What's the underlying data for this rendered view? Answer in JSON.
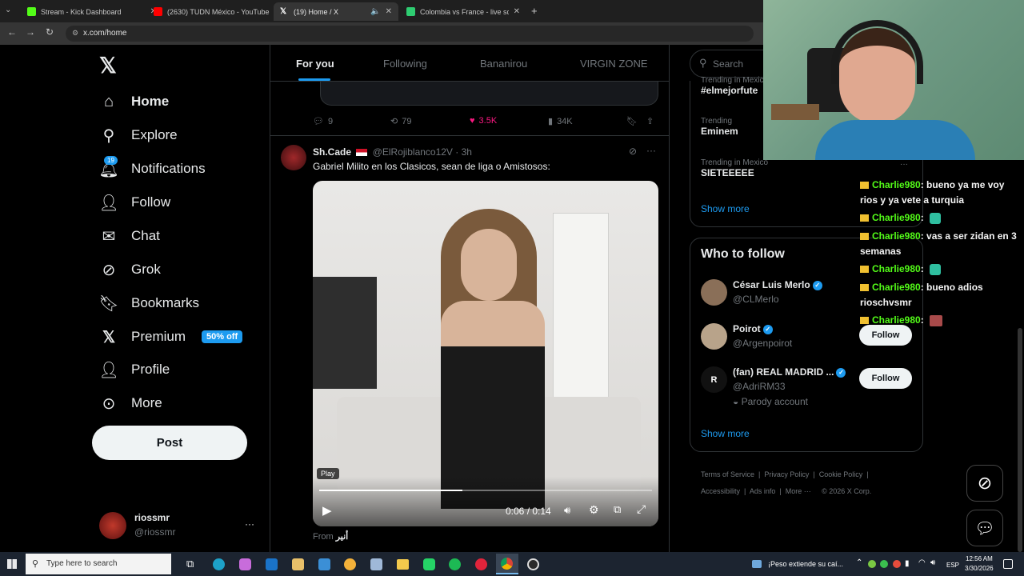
{
  "browser": {
    "tabs": [
      {
        "title": "Stream - Kick Dashboard",
        "color": "#53fc18"
      },
      {
        "title": "(2630) TUDN México - YouTube",
        "color": "#ff0000"
      },
      {
        "title": "(19) Home / X",
        "color": "#ffffff"
      },
      {
        "title": "Colombia vs France - live score",
        "color": "#2ecc71"
      }
    ],
    "url": "x.com/home"
  },
  "nav": {
    "items": [
      "Home",
      "Explore",
      "Notifications",
      "Follow",
      "Chat",
      "Grok",
      "Bookmarks",
      "Premium",
      "Profile",
      "More"
    ],
    "notif_badge": "19",
    "premium_badge": "50% off",
    "post": "Post",
    "account_name": "riossmr",
    "account_handle": "@riossmr"
  },
  "timeline": {
    "tabs": [
      "For you",
      "Following",
      "Bananirou",
      "VIRGIN ZONE"
    ],
    "prev_actions": {
      "replies": "9",
      "reposts": "79",
      "likes": "3.5K",
      "views": "34K"
    },
    "tweet": {
      "name": "Sh.Cade",
      "handle": "@ElRojiblanco12V",
      "time": "· 3h",
      "text": "Gabriel Milito en los Clasicos, sean de liga o Amistosos:",
      "play_label": "Play",
      "video_time": "0:06 / 0:14",
      "progress": 0.43,
      "from": "From",
      "from_name": "أنير"
    }
  },
  "right": {
    "search_placeholder": "Search",
    "trends": [
      {
        "meta": "Trending in Mexico",
        "name": "#elmejorfute"
      },
      {
        "meta": "Trending",
        "name": "Eminem"
      },
      {
        "meta": "Trending in Mexico",
        "name": "SIETEEEEE"
      }
    ],
    "show_more": "Show more",
    "wtf_title": "Who to follow",
    "follow_label": "Follow",
    "accounts": [
      {
        "name": "César Luis Merlo",
        "handle": "@CLMerlo"
      },
      {
        "name": "Poirot",
        "handle": "@Argenpoirot"
      },
      {
        "name": "(fan) REAL MADRID ...",
        "handle": "@AdriRM33",
        "note": "Parody account"
      }
    ],
    "footer": [
      "Terms of Service",
      "Privacy Policy",
      "Cookie Policy",
      "Accessibility",
      "Ads info",
      "More ···",
      "© 2026 X Corp."
    ]
  },
  "chat": [
    {
      "user": "Charlie980",
      "msg": ": bueno ya me voy rios y ya vete a turquia"
    },
    {
      "user": "Charlie980",
      "msg": ":"
    },
    {
      "user": "Charlie980",
      "msg": ": vas a ser zidan en 3 semanas"
    },
    {
      "user": "Charlie980",
      "msg": ":"
    },
    {
      "user": "Charlie980",
      "msg": ": bueno adios rioschvsmr"
    },
    {
      "user": "Charlie980",
      "msg": ":"
    }
  ],
  "taskbar": {
    "search_placeholder": "Type here to search",
    "notice": "¡Peso extiende su caí...",
    "lang": "ESP",
    "time": "12:56 AM",
    "date": "3/30/2026"
  }
}
